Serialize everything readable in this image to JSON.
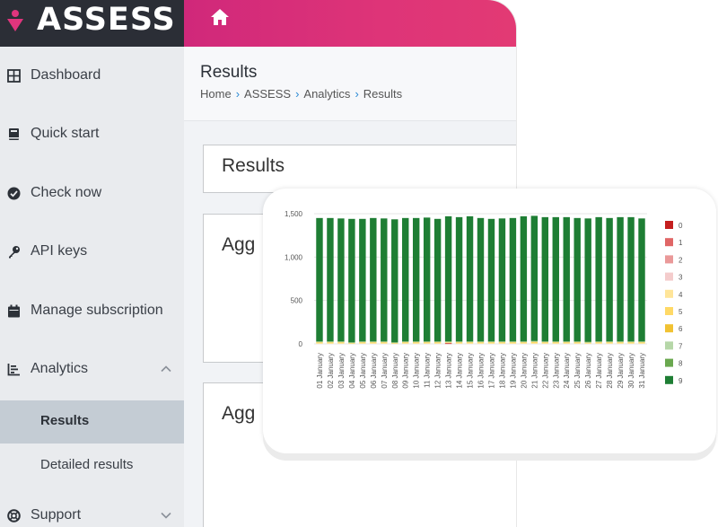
{
  "app": {
    "logo_text": "ASSESS"
  },
  "sidebar": {
    "items": [
      {
        "label": "Dashboard",
        "icon": "grid-icon"
      },
      {
        "label": "Quick start",
        "icon": "book-icon"
      },
      {
        "label": "Check now",
        "icon": "check-circle-icon"
      },
      {
        "label": "API keys",
        "icon": "key-icon"
      },
      {
        "label": "Manage subscription",
        "icon": "calendar-icon"
      },
      {
        "label": "Analytics",
        "icon": "bar-chart-icon"
      },
      {
        "label": "Support",
        "icon": "lifebuoy-icon"
      }
    ],
    "analytics_sub": [
      {
        "label": "Results",
        "active": true
      },
      {
        "label": "Detailed results",
        "active": false
      }
    ]
  },
  "page": {
    "title": "Results",
    "breadcrumb": [
      "Home",
      "ASSESS",
      "Analytics",
      "Results"
    ]
  },
  "cards": {
    "results_title": "Results",
    "agg1_title": "Agg",
    "agg2_title": "Agg"
  },
  "colors": {
    "brand_pink": "#de3478",
    "dark": "#2b2e36",
    "active_sub": "#c4ccd4"
  },
  "chart_data": {
    "type": "bar",
    "stacked": true,
    "ylim": [
      0,
      1500
    ],
    "yticks": [
      "0",
      "500",
      "1,000",
      "1,500"
    ],
    "grid": true,
    "legend_position": "right",
    "categories": [
      "01 January",
      "02 January",
      "03 January",
      "04 January",
      "05 January",
      "06 January",
      "07 January",
      "08 January",
      "09 January",
      "10 January",
      "11 January",
      "12 January",
      "13 January",
      "14 January",
      "15 January",
      "16 January",
      "17 January",
      "18 January",
      "19 January",
      "20 January",
      "21 January",
      "22 January",
      "23 January",
      "24 January",
      "25 January",
      "26 January",
      "27 January",
      "28 January",
      "29 January",
      "30 January",
      "31 January"
    ],
    "series": [
      {
        "name": "0",
        "color": "#c41e1e",
        "values": [
          0,
          0,
          0,
          0,
          0,
          0,
          0,
          0,
          0,
          0,
          0,
          0,
          5,
          0,
          0,
          0,
          0,
          0,
          0,
          0,
          0,
          0,
          0,
          0,
          0,
          0,
          0,
          0,
          0,
          0,
          0
        ]
      },
      {
        "name": "1",
        "color": "#e06666",
        "values": [
          0,
          0,
          0,
          0,
          0,
          0,
          0,
          0,
          0,
          0,
          0,
          0,
          5,
          0,
          0,
          0,
          0,
          0,
          0,
          0,
          0,
          0,
          0,
          0,
          0,
          0,
          0,
          0,
          0,
          0,
          0
        ]
      },
      {
        "name": "2",
        "color": "#ea9999",
        "values": [
          0,
          0,
          0,
          0,
          0,
          0,
          0,
          0,
          0,
          0,
          0,
          0,
          0,
          0,
          0,
          0,
          0,
          0,
          0,
          0,
          0,
          0,
          0,
          0,
          0,
          0,
          0,
          0,
          0,
          0,
          0
        ]
      },
      {
        "name": "3",
        "color": "#f4cccc",
        "values": [
          0,
          0,
          0,
          0,
          0,
          0,
          0,
          0,
          0,
          0,
          0,
          0,
          0,
          0,
          0,
          0,
          0,
          0,
          0,
          0,
          0,
          0,
          0,
          0,
          0,
          0,
          0,
          0,
          0,
          0,
          0
        ]
      },
      {
        "name": "4",
        "color": "#ffe599",
        "values": [
          10,
          10,
          10,
          5,
          10,
          10,
          10,
          5,
          10,
          10,
          10,
          10,
          5,
          10,
          10,
          10,
          10,
          10,
          10,
          10,
          10,
          10,
          10,
          10,
          10,
          10,
          10,
          10,
          10,
          10,
          10
        ]
      },
      {
        "name": "5",
        "color": "#ffd966",
        "values": [
          10,
          10,
          10,
          5,
          10,
          10,
          10,
          5,
          10,
          10,
          10,
          10,
          5,
          10,
          10,
          10,
          10,
          10,
          10,
          10,
          15,
          10,
          10,
          10,
          10,
          5,
          10,
          10,
          10,
          10,
          10
        ]
      },
      {
        "name": "6",
        "color": "#f1c232",
        "values": [
          0,
          0,
          0,
          0,
          0,
          0,
          0,
          0,
          0,
          0,
          0,
          0,
          0,
          0,
          0,
          0,
          0,
          0,
          0,
          0,
          0,
          0,
          0,
          0,
          0,
          0,
          0,
          0,
          0,
          0,
          0
        ]
      },
      {
        "name": "7",
        "color": "#b6d7a8",
        "values": [
          5,
          5,
          5,
          5,
          5,
          5,
          5,
          5,
          5,
          5,
          5,
          5,
          5,
          5,
          5,
          5,
          5,
          5,
          5,
          5,
          5,
          5,
          5,
          5,
          5,
          5,
          5,
          5,
          5,
          5,
          5
        ]
      },
      {
        "name": "8",
        "color": "#6aa84f",
        "values": [
          5,
          5,
          5,
          5,
          5,
          5,
          5,
          5,
          5,
          5,
          5,
          5,
          5,
          5,
          5,
          5,
          5,
          5,
          5,
          5,
          5,
          5,
          5,
          5,
          5,
          5,
          5,
          5,
          5,
          5,
          5
        ]
      },
      {
        "name": "9",
        "color": "#1e7e34",
        "values": [
          1420,
          1420,
          1415,
          1420,
          1410,
          1420,
          1415,
          1415,
          1420,
          1420,
          1425,
          1410,
          1440,
          1430,
          1440,
          1420,
          1410,
          1415,
          1420,
          1440,
          1440,
          1430,
          1430,
          1430,
          1420,
          1420,
          1430,
          1420,
          1430,
          1430,
          1415
        ]
      }
    ]
  }
}
